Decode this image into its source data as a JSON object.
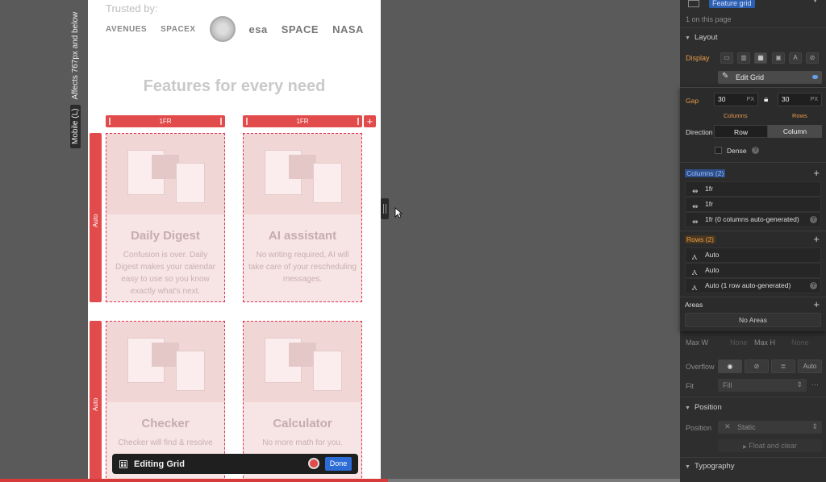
{
  "canvas": {
    "breakpoint_chip": "Mobile (L)",
    "breakpoint_note": "Affects 767px and below",
    "trusted_by": "Trusted by:",
    "logos": [
      "AVENUES",
      "SPACEX",
      "esa",
      "SPACE",
      "NASA"
    ],
    "features_title": "Features for every need",
    "column_tracks": [
      "1FR",
      "1FR"
    ],
    "add_column": "+",
    "row_tracks": [
      "Auto",
      "Auto"
    ],
    "cards": [
      {
        "title": "Daily Digest",
        "desc": "Confusion is over. Daily Digest makes your calendar easy to use so you know exactly what's next."
      },
      {
        "title": "AI assistant",
        "desc": "No writing required, AI will take care of your rescheduling messages."
      },
      {
        "title": "Checker",
        "desc": "Checker will find & resolve"
      },
      {
        "title": "Calculator",
        "desc": "No more math for you."
      }
    ],
    "editing_toolbar": {
      "label": "Editing Grid",
      "done": "Done"
    },
    "progress": 0.47
  },
  "panel": {
    "selector": "Feature grid",
    "on_page": "1 on this page",
    "layout_header": "Layout",
    "display_label": "Display",
    "edit_grid": "Edit Grid",
    "max_w_label": "Max W",
    "max_w_value": "None",
    "max_h_label": "Max H",
    "max_h_value": "None",
    "overflow_label": "Overflow",
    "overflow_auto": "Auto",
    "fit_label": "Fit",
    "fit_value": "Fill",
    "position_header": "Position",
    "position_label": "Position",
    "position_value": "Static",
    "float_clear": "Float and clear",
    "typography_header": "Typography"
  },
  "grid_popover": {
    "gap_label": "Gap",
    "col_gap": "30",
    "row_gap": "30",
    "unit": "PX",
    "columns_sub": "Columns",
    "rows_sub": "Rows",
    "direction_label": "Direction",
    "direction_row": "Row",
    "direction_column": "Column",
    "dense_label": "Dense",
    "columns_header": "Columns (2)",
    "columns": [
      "1fr",
      "1fr",
      "1fr (0 columns auto-generated)"
    ],
    "rows_header": "Rows (2)",
    "rows": [
      "Auto",
      "Auto",
      "Auto (1 row auto-generated)"
    ],
    "areas_header": "Areas",
    "no_areas": "No Areas"
  },
  "colors": {
    "accent_red": "#e24b4b",
    "done_blue": "#2d6bd6",
    "label_orange": "#e69a4a",
    "label_blue": "#6a9ee8"
  }
}
